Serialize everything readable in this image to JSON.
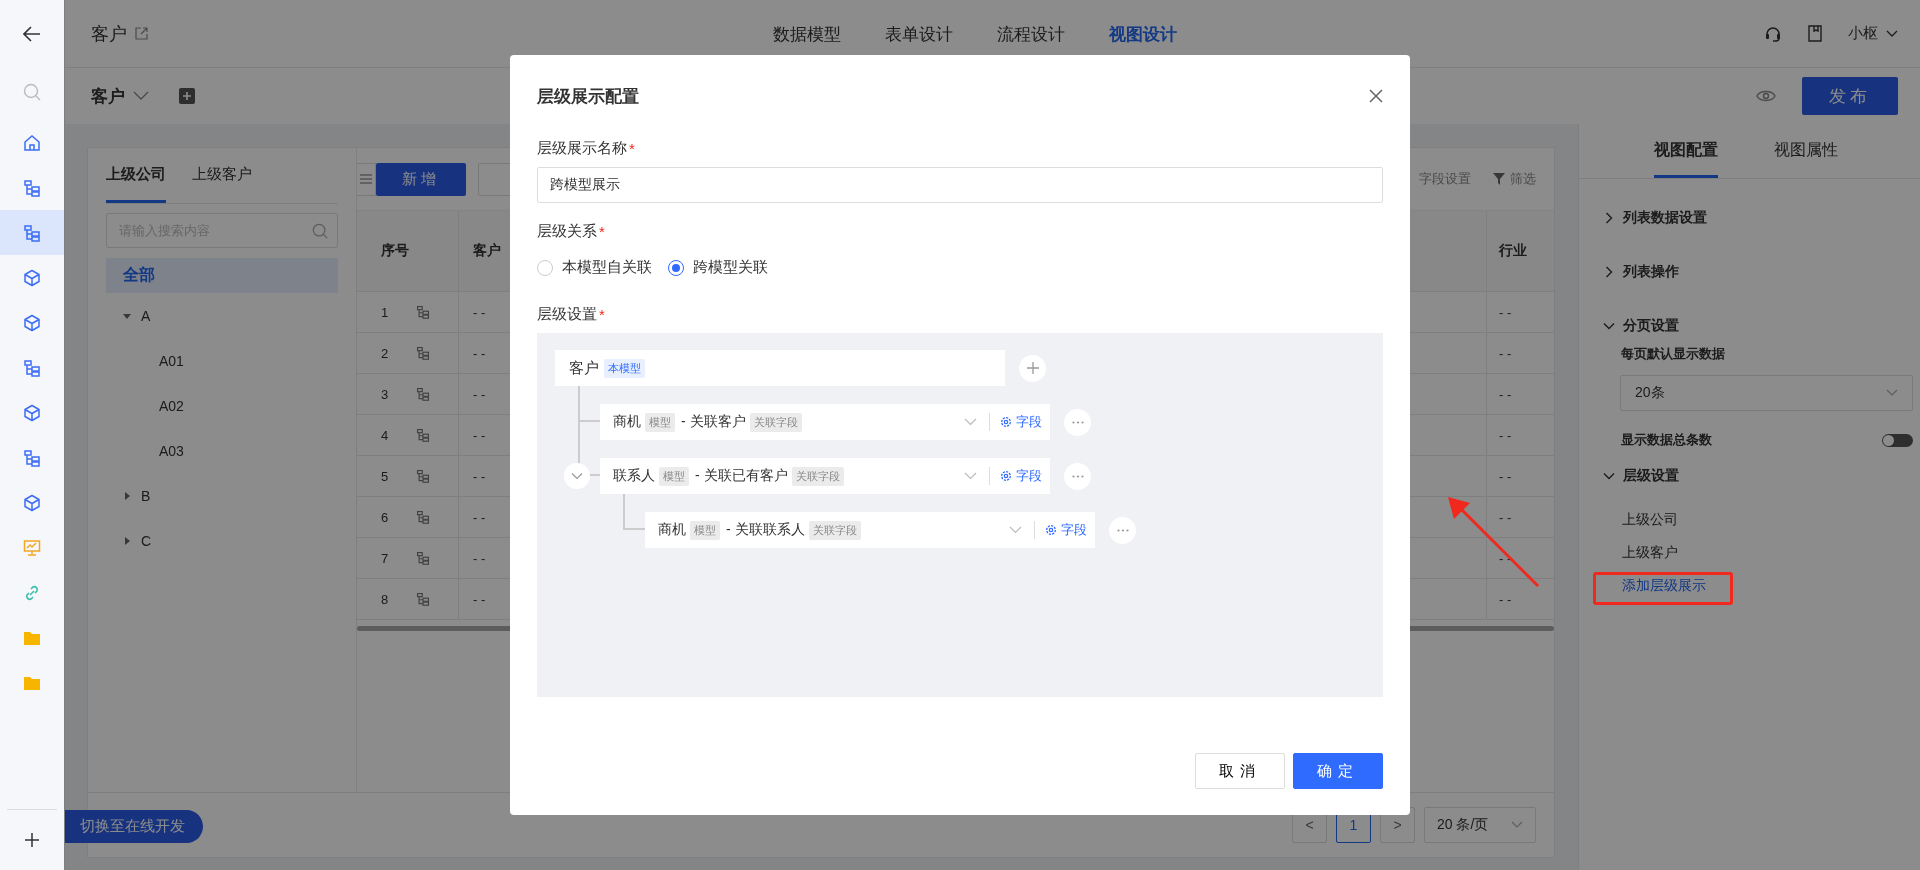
{
  "nav_rail": {
    "items": [
      {
        "kind": "home",
        "selected": false
      },
      {
        "kind": "tree",
        "selected": false
      },
      {
        "kind": "tree",
        "selected": true
      },
      {
        "kind": "cube",
        "selected": false
      },
      {
        "kind": "cube",
        "selected": false
      },
      {
        "kind": "tree",
        "selected": false
      },
      {
        "kind": "cube",
        "selected": false
      },
      {
        "kind": "tree",
        "selected": false
      },
      {
        "kind": "cube",
        "selected": false
      },
      {
        "kind": "screen",
        "selected": false
      },
      {
        "kind": "link",
        "selected": false
      },
      {
        "kind": "folder",
        "selected": false
      },
      {
        "kind": "folder",
        "selected": false
      }
    ]
  },
  "header": {
    "title": "客户",
    "tabs": [
      {
        "label": "数据模型",
        "selected": false
      },
      {
        "label": "表单设计",
        "selected": false
      },
      {
        "label": "流程设计",
        "selected": false
      },
      {
        "label": "视图设计",
        "selected": true
      }
    ],
    "user": "小枢"
  },
  "toolbar": {
    "title": "客户",
    "publish": "发布"
  },
  "tree_panel": {
    "tabs": [
      {
        "label": "上级公司",
        "selected": true
      },
      {
        "label": "上级客户",
        "selected": false
      }
    ],
    "placeholder": "请输入搜索内容",
    "all": {
      "label": "全部",
      "selected": true
    },
    "nodes": [
      {
        "label": "A",
        "expanded": true,
        "children": [
          {
            "label": "A01"
          },
          {
            "label": "A02"
          },
          {
            "label": "A03"
          }
        ]
      },
      {
        "label": "B",
        "expanded": false
      },
      {
        "label": "C",
        "expanded": false
      }
    ]
  },
  "switch_button": "切换至在线开发",
  "table": {
    "add_button": "新增",
    "field_settings": "字段设置",
    "filter": "筛选",
    "columns": [
      "序号",
      "客户",
      "行业"
    ],
    "rows": [
      {
        "index": "1",
        "name": "- -",
        "industry": "- -"
      },
      {
        "index": "2",
        "name": "- -",
        "industry": "- -"
      },
      {
        "index": "3",
        "name": "- -",
        "industry": "- -"
      },
      {
        "index": "4",
        "name": "- -",
        "industry": "- -"
      },
      {
        "index": "5",
        "name": "- -",
        "industry": "- -"
      },
      {
        "index": "6",
        "name": "- -",
        "industry": "- -"
      },
      {
        "index": "7",
        "name": "- -",
        "industry": "- -"
      },
      {
        "index": "8",
        "name": "- -",
        "industry": "- -"
      }
    ],
    "pagination": {
      "prev": "<",
      "page": "1",
      "next": ">",
      "page_size": "20 条/页"
    }
  },
  "right_panel": {
    "tabs": [
      {
        "label": "视图配置",
        "selected": true
      },
      {
        "label": "视图属性",
        "selected": false
      }
    ],
    "sections": [
      {
        "title": "列表数据设置",
        "expanded": false
      },
      {
        "title": "列表操作",
        "expanded": false
      },
      {
        "title": "分页设置",
        "expanded": true,
        "fields": [
          {
            "kind": "select",
            "label": "每页默认显示数据",
            "value": "20条"
          },
          {
            "kind": "toggle",
            "label": "显示数据总条数",
            "on": false
          }
        ]
      },
      {
        "title": "层级设置",
        "expanded": true,
        "items": [
          {
            "kind": "item",
            "label": "上级公司",
            "highlighted": false
          },
          {
            "kind": "item",
            "label": "上级客户",
            "highlighted": false
          },
          {
            "kind": "link",
            "label": "添加层级展示",
            "highlighted": true
          }
        ]
      }
    ]
  },
  "dialog": {
    "title": "层级展示配置",
    "name_field": {
      "label": "层级展示名称",
      "required_mark": "*",
      "value": "跨模型展示"
    },
    "relation": {
      "label": "层级关系",
      "required_mark": "*",
      "options": [
        {
          "label": "本模型自关联",
          "selected": false
        },
        {
          "label": "跨模型关联",
          "selected": true
        }
      ]
    },
    "levels": {
      "label": "层级设置",
      "required_mark": "*",
      "root": {
        "name": "客户",
        "tag": "本模型",
        "children": [
          {
            "model": "商机",
            "model_tag": "模型",
            "field": "- 关联客户",
            "field_tag": "关联字段",
            "action": "字段"
          },
          {
            "model": "联系人",
            "model_tag": "模型",
            "field": "- 关联已有客户",
            "field_tag": "关联字段",
            "action": "字段",
            "expanded": true,
            "children": [
              {
                "model": "商机",
                "model_tag": "模型",
                "field": "- 关联联系人",
                "field_tag": "关联字段",
                "action": "字段"
              }
            ]
          }
        ]
      }
    },
    "cancel": "取消",
    "confirm": "确定"
  }
}
